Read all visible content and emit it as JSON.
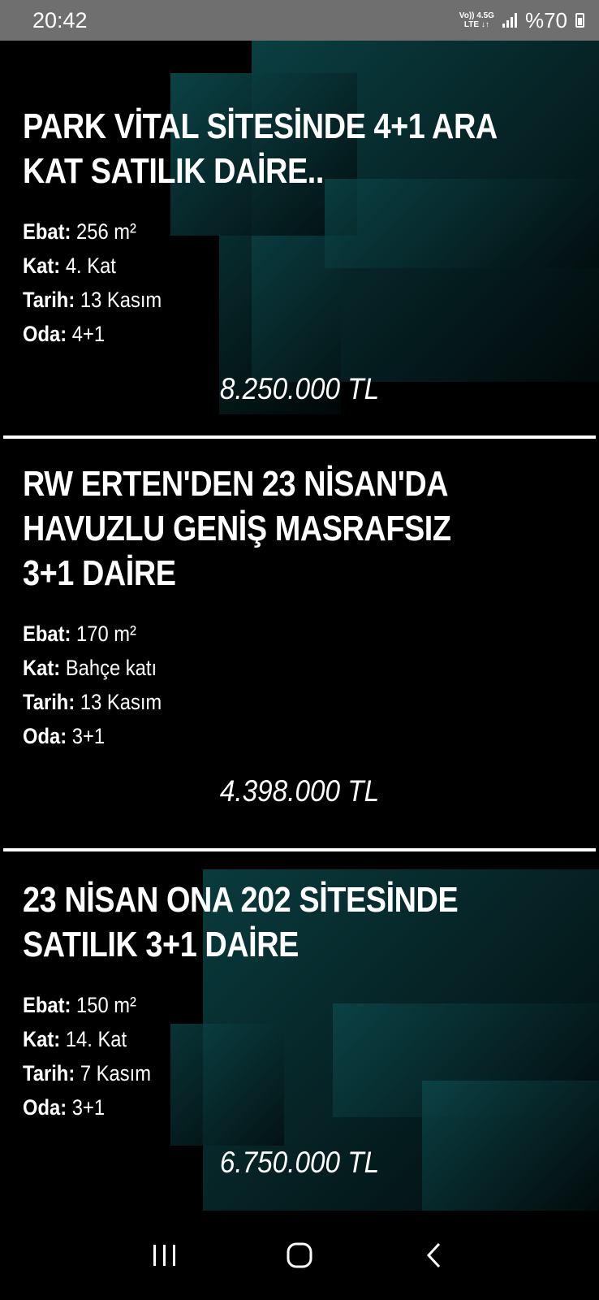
{
  "status_bar": {
    "time": "20:42",
    "network_top": "Vo)) 4.5G",
    "network_bottom": "LTE ↓↑",
    "battery": "%70"
  },
  "listings": [
    {
      "title": "PARK VİTAL SİTESİNDE 4+1 ARA KAT SATILIK DAİRE..",
      "ebat_label": "Ebat:",
      "ebat": "256 m²",
      "kat_label": "Kat:",
      "kat": "4. Kat",
      "tarih_label": "Tarih:",
      "tarih": "13 Kasım",
      "oda_label": "Oda:",
      "oda": "4+1",
      "price": "8.250.000 TL"
    },
    {
      "title": "RW ERTEN'DEN 23 NİSAN'DA HAVUZLU GENİŞ MASRAFSIZ 3+1 DAİRE",
      "ebat_label": "Ebat:",
      "ebat": "170 m²",
      "kat_label": "Kat:",
      "kat": "Bahçe katı",
      "tarih_label": "Tarih:",
      "tarih": "13 Kasım",
      "oda_label": "Oda:",
      "oda": "3+1",
      "price": "4.398.000 TL"
    },
    {
      "title": "23 NİSAN ONA 202 SİTESİNDE SATILIK 3+1 DAİRE",
      "ebat_label": "Ebat:",
      "ebat": "150 m²",
      "kat_label": "Kat:",
      "kat": "14. Kat",
      "tarih_label": "Tarih:",
      "tarih": "7 Kasım",
      "oda_label": "Oda:",
      "oda": "3+1",
      "price": "6.750.000 TL"
    }
  ],
  "nav_bar": {
    "recent_icon": "recent-apps-icon",
    "home_icon": "home-icon",
    "back_icon": "back-icon"
  },
  "colors": {
    "status_bar_bg": "#6f6f6f",
    "background": "#000000",
    "accent_teal": "#0c4a4d",
    "text": "#ffffff"
  }
}
